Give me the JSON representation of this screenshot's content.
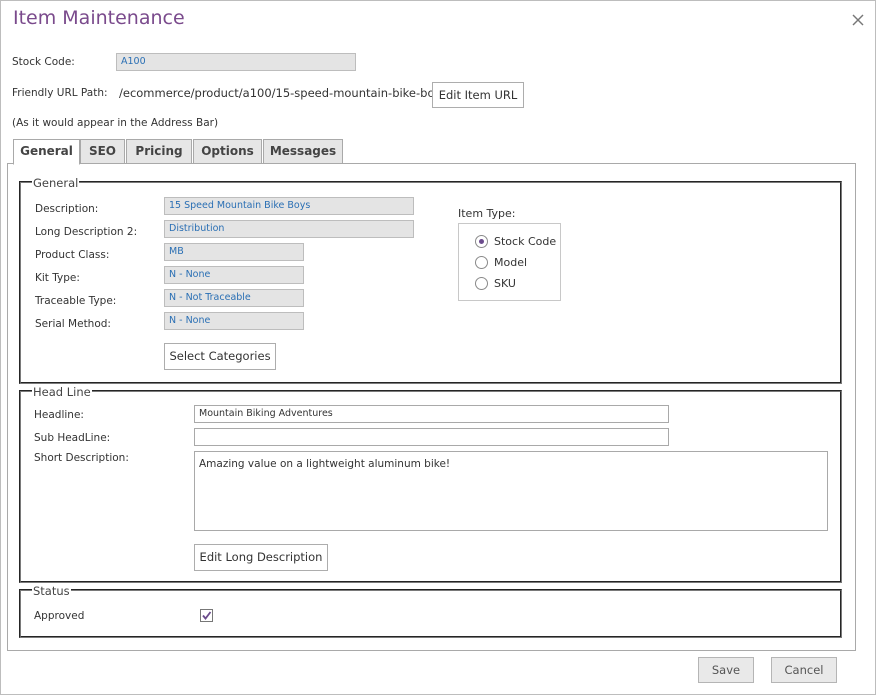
{
  "window": {
    "title": "Item Maintenance"
  },
  "stock_code": {
    "label": "Stock Code:",
    "value": "A100"
  },
  "friendly_url": {
    "label": "Friendly URL Path:",
    "value": "/ecommerce/product/a100/15-speed-mountain-bike-boys",
    "edit_button": "Edit Item URL",
    "note": "(As it would appear in the Address Bar)"
  },
  "tabs": [
    {
      "label": "General",
      "active": true
    },
    {
      "label": "SEO",
      "active": false
    },
    {
      "label": "Pricing",
      "active": false
    },
    {
      "label": "Options",
      "active": false
    },
    {
      "label": "Messages",
      "active": false
    }
  ],
  "general": {
    "legend": "General",
    "fields": [
      {
        "label": "Description:",
        "value": "15 Speed Mountain Bike Boys"
      },
      {
        "label": "Long Description 2:",
        "value": "Distribution"
      },
      {
        "label": "Product Class:",
        "value": "MB"
      },
      {
        "label": "Kit Type:",
        "value": "N - None"
      },
      {
        "label": "Traceable Type:",
        "value": "N - Not Traceable"
      },
      {
        "label": "Serial Method:",
        "value": "N - None"
      }
    ],
    "select_categories_button": "Select Categories",
    "item_type": {
      "label": "Item Type:",
      "options": [
        {
          "label": "Stock Code",
          "selected": true
        },
        {
          "label": "Model",
          "selected": false
        },
        {
          "label": "SKU",
          "selected": false
        }
      ]
    }
  },
  "headline": {
    "legend": "Head Line",
    "headline_label": "Headline:",
    "headline_value": "Mountain Biking Adventures",
    "sub_headline_label": "Sub HeadLine:",
    "sub_headline_value": "",
    "short_description_label": "Short Description:",
    "short_description_value": "Amazing value on a lightweight aluminum bike!",
    "edit_long_description_button": "Edit Long Description"
  },
  "status": {
    "legend": "Status",
    "approved_label": "Approved",
    "approved_checked": true
  },
  "footer": {
    "save_label": "Save",
    "cancel_label": "Cancel"
  },
  "colors": {
    "title": "#7a4a8c",
    "readonly_text": "#2a6fb4",
    "accent": "#6b4b8c"
  }
}
